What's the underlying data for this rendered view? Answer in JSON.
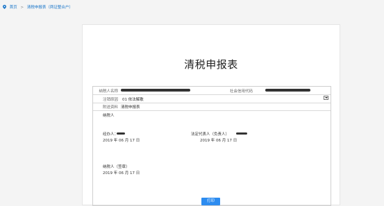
{
  "breadcrumb": {
    "home": "首页",
    "separator": ">",
    "current": "清税申报表（两证整合户）"
  },
  "title": "清税申报表",
  "form": {
    "taxpayer_name_label": "纳税人名称",
    "credit_code_label": "社会信用代码",
    "reason_label": "注销原因",
    "reason_value": "01 依法解散",
    "attachment_label": "附送资料",
    "attachment_value": "清税申报表",
    "taxpayer_label": "纳税人",
    "handler_label": "经办人：",
    "handler_date": "2019 年 06 月 17 日",
    "legal_rep_label": "法定代表人（负责人）",
    "legal_rep_date": "2019 年 06 月 17 日",
    "seal_label": "纳税人（签章）",
    "seal_date": "2019 年 06 月 17 日"
  },
  "print_button": "打印",
  "colors": {
    "accent": "#2d8cf0",
    "link": "#1a76c9"
  }
}
